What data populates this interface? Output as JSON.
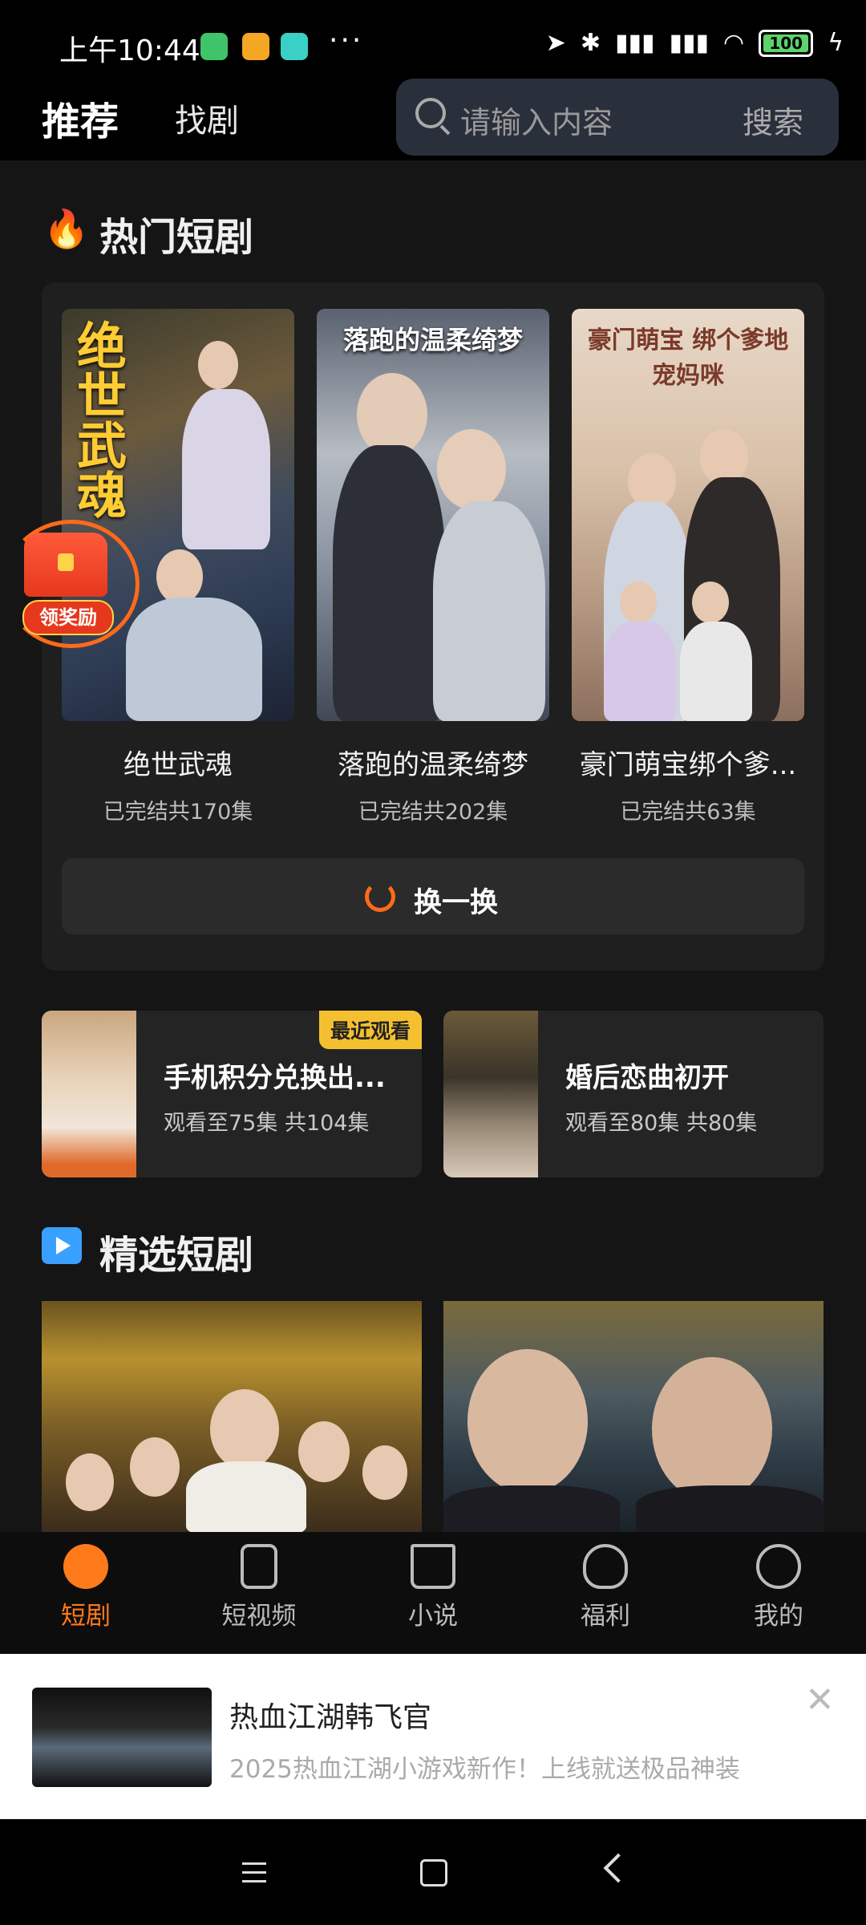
{
  "status_bar": {
    "time": "上午10:44",
    "dots": "···",
    "battery": "100"
  },
  "header": {
    "tabs": [
      {
        "label": "推荐"
      },
      {
        "label": "找剧"
      }
    ],
    "search": {
      "placeholder": "请输入内容",
      "button": "搜索"
    }
  },
  "hot_section": {
    "title": "热门短剧",
    "items": [
      {
        "poster_text": "绝世武魂",
        "title": "绝世武魂",
        "status": "已完结共170集"
      },
      {
        "poster_text": "落跑的温柔绮梦",
        "title": "落跑的温柔绮梦",
        "status": "已完结共202集"
      },
      {
        "poster_text": "豪门萌宝 绑个爹地宠妈咪",
        "title": "豪门萌宝绑个爹...",
        "status": "已完结共63集"
      }
    ],
    "refresh_label": "换一换"
  },
  "reward_badge": {
    "label": "领奖励"
  },
  "recent": {
    "badge": "最近观看",
    "items": [
      {
        "title": "手机积分兑换出...",
        "progress": "观看至75集 共104集"
      },
      {
        "title": "婚后恋曲初开",
        "progress": "观看至80集 共80集"
      }
    ]
  },
  "featured_section": {
    "title": "精选短剧"
  },
  "bottom_nav": {
    "items": [
      {
        "label": "短剧",
        "icon": "drama-icon",
        "active": true
      },
      {
        "label": "短视频",
        "icon": "video-icon",
        "active": false
      },
      {
        "label": "小说",
        "icon": "book-icon",
        "active": false
      },
      {
        "label": "福利",
        "icon": "gift-icon",
        "active": false
      },
      {
        "label": "我的",
        "icon": "profile-icon",
        "active": false
      }
    ]
  },
  "ad": {
    "title": "热血江湖韩飞官",
    "description": "2025热血江湖小游戏新作！上线就送极品神装"
  },
  "colors": {
    "accent": "#ff7a1a",
    "badge": "#f5c030",
    "background": "#151515"
  }
}
